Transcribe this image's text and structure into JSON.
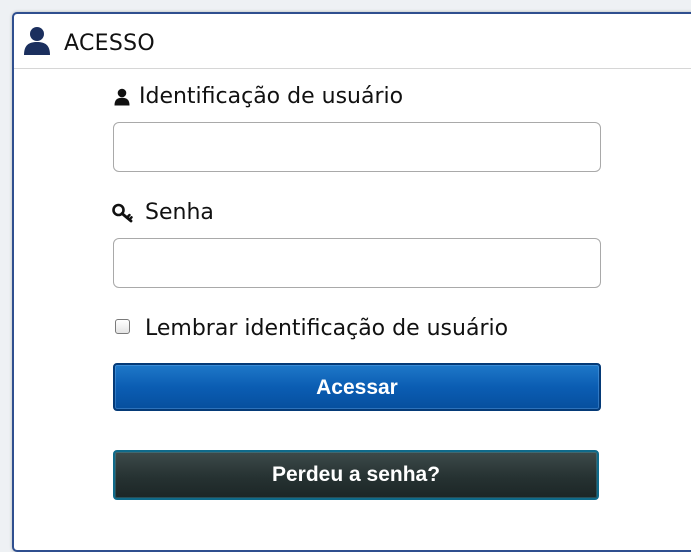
{
  "header": {
    "title": "ACESSO",
    "icon": "user-icon"
  },
  "form": {
    "username": {
      "label": "Identificação de usuário",
      "icon": "user-icon",
      "value": "",
      "placeholder": ""
    },
    "password": {
      "label": "Senha",
      "icon": "key-icon",
      "value": "",
      "placeholder": ""
    },
    "remember": {
      "label": "Lembrar identificação de usuário",
      "checked": false
    },
    "submit_label": "Acessar",
    "forgot_label": "Perdeu a senha?"
  },
  "colors": {
    "panel_border": "#2f4f8f",
    "header_icon": "#1b2f5e",
    "primary_button": "#0b5db3",
    "secondary_button": "#263232",
    "secondary_border": "#0f6a8a"
  }
}
